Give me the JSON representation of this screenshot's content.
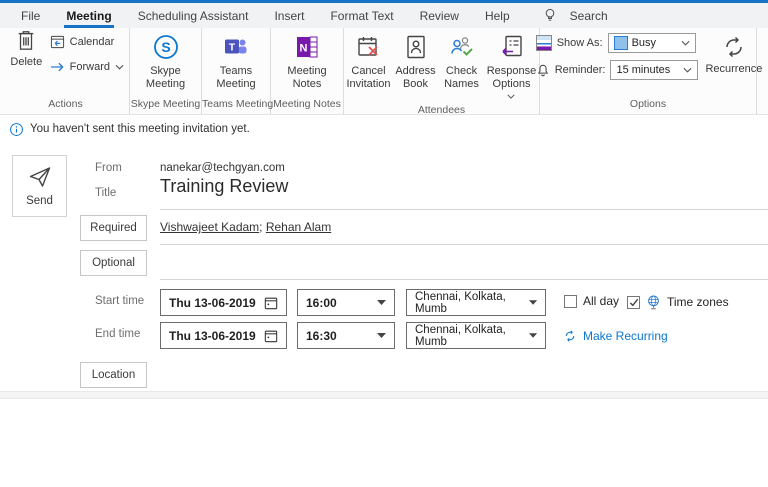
{
  "window": {
    "accent_color": "#1673c6",
    "link_color": "#0b77d0"
  },
  "menu": {
    "tabs": [
      "File",
      "Meeting",
      "Scheduling Assistant",
      "Insert",
      "Format Text",
      "Review",
      "Help"
    ],
    "active_tab": "Meeting",
    "search_label": "Search"
  },
  "ribbon": {
    "actions": {
      "group_label": "Actions",
      "delete_label": "Delete",
      "calendar_label": "Calendar",
      "forward_label": "Forward"
    },
    "skype": {
      "group_label": "Skype Meeting",
      "button_label": "Skype\nMeeting"
    },
    "teams": {
      "group_label": "Teams Meeting",
      "button_label": "Teams\nMeeting"
    },
    "notes": {
      "group_label": "Meeting Notes",
      "button_label": "Meeting\nNotes"
    },
    "attendees": {
      "group_label": "Attendees",
      "cancel_label": "Cancel\nInvitation",
      "address_label": "Address\nBook",
      "check_label": "Check\nNames",
      "response_label": "Response\nOptions"
    },
    "options": {
      "group_label": "Options",
      "show_as_label": "Show As:",
      "show_as_value": "Busy",
      "busy_color": "#8fc1ea",
      "reminder_label": "Reminder:",
      "reminder_value": "15 minutes",
      "recurrence_label": "Recurrence"
    }
  },
  "infobar": {
    "text": "You haven't sent this meeting invitation yet."
  },
  "compose": {
    "send_label": "Send",
    "from_label": "From",
    "from_value": "nanekar@techgyan.com",
    "title_label": "Title",
    "title_value": "Training Review",
    "required_label": "Required",
    "attendees": [
      "Vishwajeet Kadam",
      "Rehan Alam"
    ],
    "attendee_separator": "; ",
    "optional_label": "Optional",
    "start_label": "Start time",
    "end_label": "End time",
    "start_date": "Thu 13-06-2019",
    "start_time": "16:00",
    "end_date": "Thu 13-06-2019",
    "end_time": "16:30",
    "timezone": "Chennai, Kolkata, Mumb",
    "all_day_label": "All day",
    "time_zones_label": "Time zones",
    "make_recurring_label": "Make Recurring",
    "location_label": "Location"
  }
}
